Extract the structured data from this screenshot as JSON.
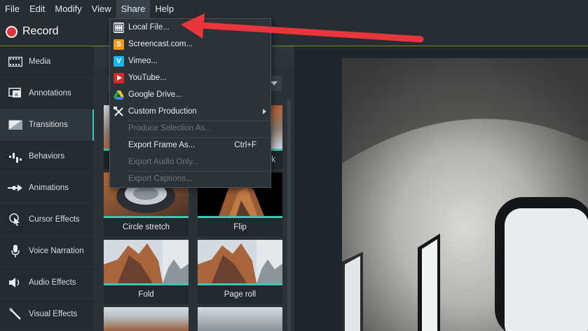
{
  "menubar": {
    "items": [
      "File",
      "Edit",
      "Modify",
      "View",
      "Share",
      "Help"
    ],
    "active_index": 4
  },
  "record": {
    "label": "Record"
  },
  "sidebar": {
    "items": [
      {
        "label": "Media",
        "icon": "film-strip-icon"
      },
      {
        "label": "Annotations",
        "icon": "annotation-icon"
      },
      {
        "label": "Transitions",
        "icon": "transition-icon",
        "active": true
      },
      {
        "label": "Behaviors",
        "icon": "behaviors-icon"
      },
      {
        "label": "Animations",
        "icon": "animation-arrow-icon"
      },
      {
        "label": "Cursor Effects",
        "icon": "cursor-icon"
      },
      {
        "label": "Voice Narration",
        "icon": "microphone-icon"
      },
      {
        "label": "Audio Effects",
        "icon": "speaker-icon"
      },
      {
        "label": "Visual Effects",
        "icon": "magic-wand-icon"
      }
    ]
  },
  "library": {
    "partial_caption": "k",
    "thumbnails": [
      {
        "caption": "Circle stretch"
      },
      {
        "caption": "Flip"
      },
      {
        "caption": "Fold"
      },
      {
        "caption": "Page roll"
      }
    ]
  },
  "share_menu": {
    "items": [
      {
        "label": "Local File...",
        "icon": "local-file-icon",
        "enabled": true
      },
      {
        "label": "Screencast.com...",
        "icon": "screencast-icon",
        "enabled": true
      },
      {
        "label": "Vimeo...",
        "icon": "vimeo-icon",
        "enabled": true
      },
      {
        "label": "YouTube...",
        "icon": "youtube-icon",
        "enabled": true
      },
      {
        "label": "Google Drive...",
        "icon": "google-drive-icon",
        "enabled": true
      },
      {
        "label": "Custom Production",
        "icon": "tools-icon",
        "enabled": true,
        "submenu": true
      },
      {
        "label": "Produce Selection As...",
        "enabled": false
      },
      {
        "label": "Export Frame As...",
        "enabled": true,
        "shortcut": "Ctrl+F"
      },
      {
        "label": "Export Audio Only...",
        "enabled": false
      },
      {
        "label": "Export Captions...",
        "enabled": false
      }
    ]
  },
  "colors": {
    "accent": "#3cc4b4",
    "record": "#e0333a",
    "annotation_arrow": "#e8363c"
  }
}
